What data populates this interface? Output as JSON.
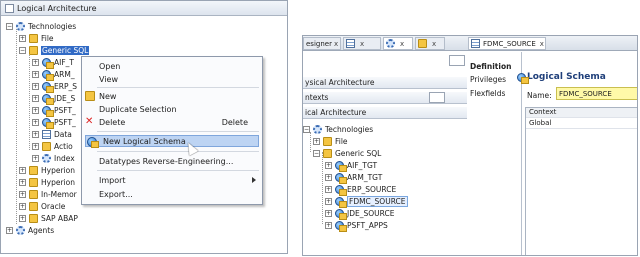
{
  "left_panel": {
    "title": "Logical Architecture",
    "tree": [
      {
        "label": "Technologies",
        "icon": "gear"
      },
      {
        "label": "File",
        "icon": "folder"
      },
      {
        "label": "Generic SQL",
        "icon": "folder"
      },
      {
        "label": "AIF_T",
        "icon": "globe"
      },
      {
        "label": "ARM_",
        "icon": "globe"
      },
      {
        "label": "ERP_S",
        "icon": "globe"
      },
      {
        "label": "JDE_S",
        "icon": "globe"
      },
      {
        "label": "PSFT_",
        "icon": "globe"
      },
      {
        "label": "PSFT_",
        "icon": "globe"
      },
      {
        "label": "Data",
        "icon": "table"
      },
      {
        "label": "Actio",
        "icon": "folder"
      },
      {
        "label": "Index",
        "icon": "gear"
      },
      {
        "label": "Hyperion",
        "icon": "folder"
      },
      {
        "label": "Hyperion",
        "icon": "folder"
      },
      {
        "label": "In-Memor",
        "icon": "folder"
      },
      {
        "label": "Oracle",
        "icon": "folder"
      },
      {
        "label": "SAP ABAP",
        "icon": "folder"
      },
      {
        "label": "Agents",
        "icon": "gear"
      }
    ],
    "context_menu": {
      "items": [
        {
          "label": "Open",
          "shortcut": ""
        },
        {
          "label": "View",
          "shortcut": ""
        },
        {
          "label": "New",
          "shortcut": ""
        },
        {
          "label": "Duplicate Selection",
          "shortcut": ""
        },
        {
          "label": "Delete",
          "shortcut": "Delete"
        },
        {
          "label": "New Logical Schema",
          "shortcut": ""
        },
        {
          "label": "Datatypes Reverse-Engineering...",
          "shortcut": ""
        },
        {
          "label": "Import",
          "shortcut": ""
        },
        {
          "label": "Export...",
          "shortcut": ""
        }
      ]
    }
  },
  "right_panel": {
    "tabs": [
      {
        "label": "esigner"
      },
      {
        "label": ""
      },
      {
        "label": ""
      }
    ],
    "editor_tab": "FDMC_SOURCE",
    "sections": [
      "ysical Architecture",
      "ntexts",
      "ical Architecture"
    ],
    "tree": [
      {
        "label": "Technologies",
        "icon": "gear"
      },
      {
        "label": "File",
        "icon": "folder"
      },
      {
        "label": "Generic SQL",
        "icon": "folder"
      },
      {
        "label": "AIF_TGT",
        "icon": "globe"
      },
      {
        "label": "ARM_TGT",
        "icon": "globe"
      },
      {
        "label": "ERP_SOURCE",
        "icon": "globe"
      },
      {
        "label": "FDMC_SOURCE",
        "icon": "globe"
      },
      {
        "label": "JDE_SOURCE",
        "icon": "globe"
      },
      {
        "label": "PSFT_APPS",
        "icon": "globe"
      }
    ],
    "nav": [
      "Definition",
      "Privileges",
      "Flexfields"
    ],
    "form": {
      "title": "Logical Schema",
      "name_label": "Name:",
      "name_value": "FDMC_SOURCE",
      "grid_header": "Context",
      "grid_rows": [
        "Global"
      ]
    }
  },
  "colors": {
    "selection": "#316ac5",
    "menu_highlight": "#bdd4f3",
    "name_highlight": "#fff9a8"
  }
}
